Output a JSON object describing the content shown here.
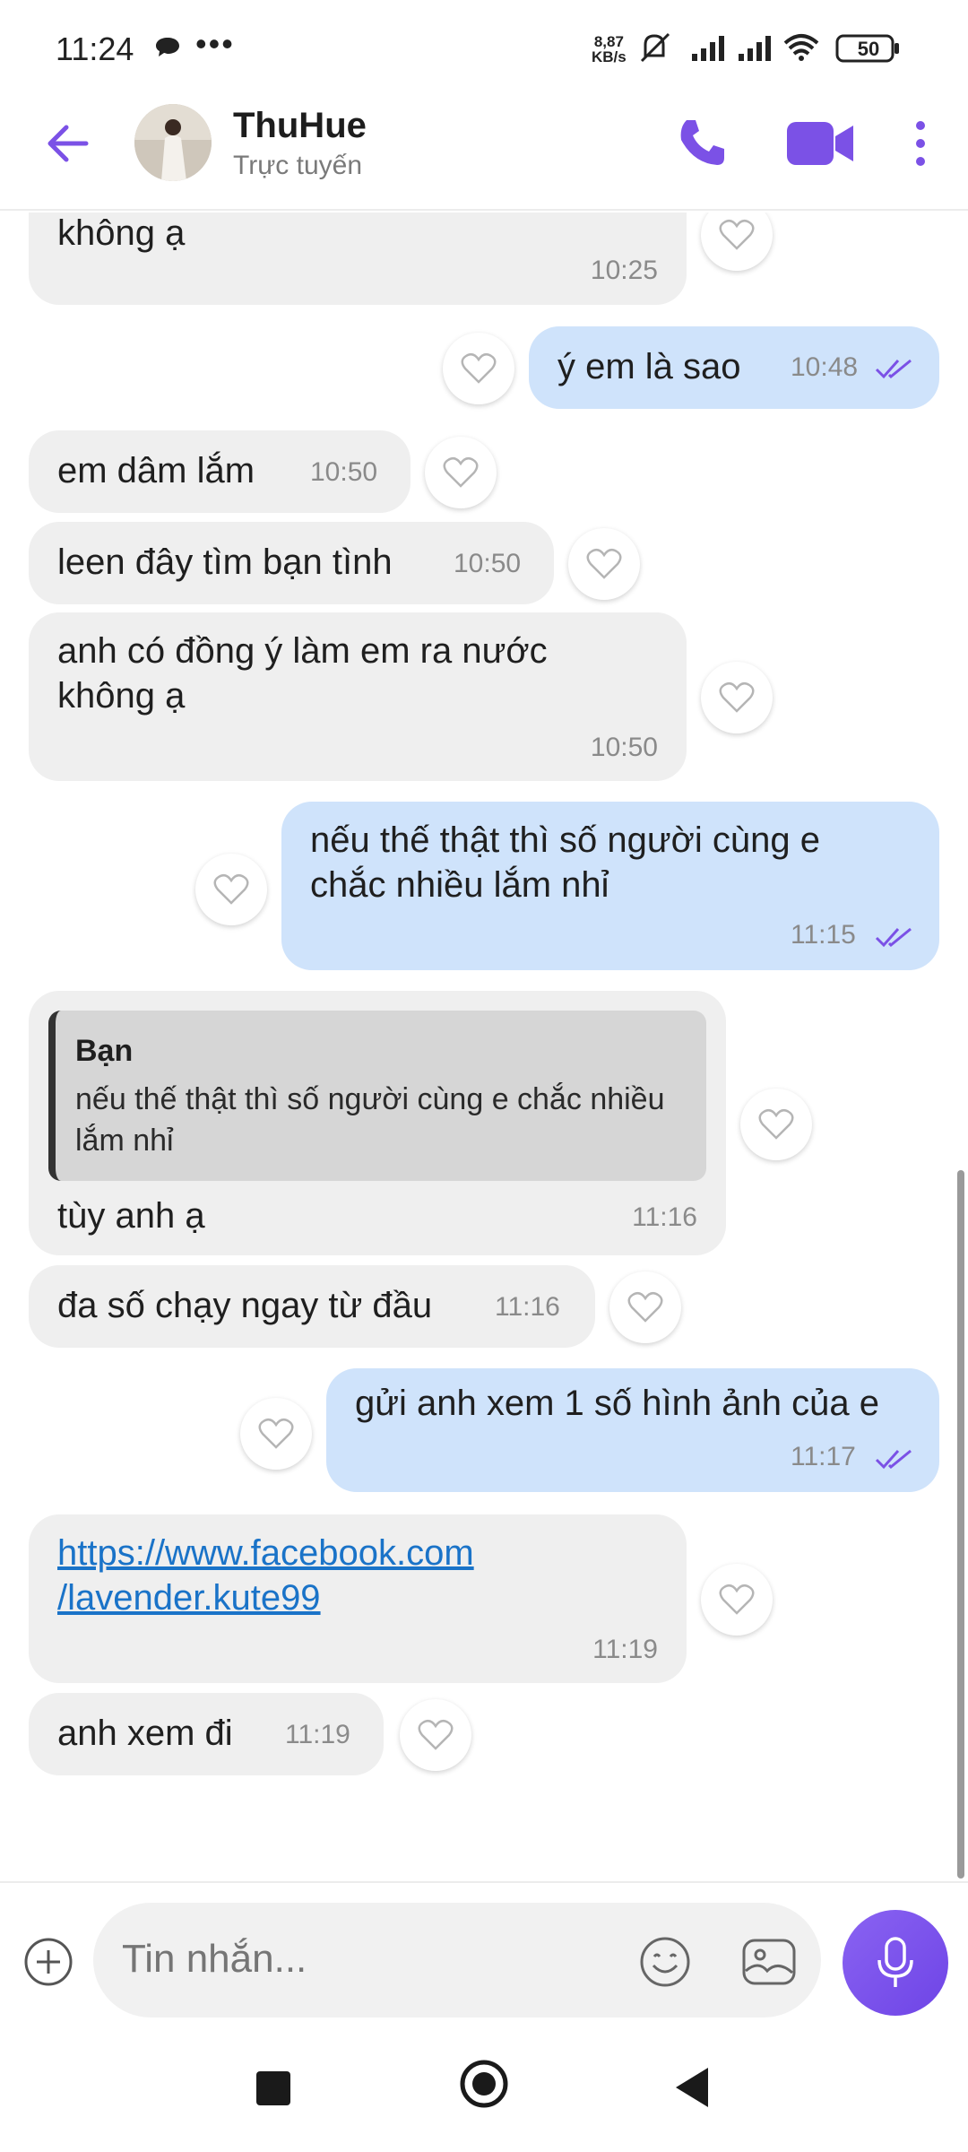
{
  "status_bar": {
    "time": "11:24",
    "dots": "•••",
    "speed_value": "8,87",
    "speed_unit": "KB/s",
    "battery": "50",
    "icons": [
      "chat-bubble-icon",
      "mute-icon",
      "signal-icon",
      "signal-icon",
      "wifi-icon",
      "battery-icon"
    ]
  },
  "header": {
    "contact_name": "ThuHue",
    "status": "Trực tuyến",
    "accent_color": "#7b51e6"
  },
  "messages": [
    {
      "dir": "in",
      "text": "không ạ",
      "time": "10:25"
    },
    {
      "dir": "out",
      "text": "ý em là sao",
      "time": "10:48",
      "read": true
    },
    {
      "dir": "in",
      "text": "em dâm lắm",
      "time": "10:50"
    },
    {
      "dir": "in",
      "text": "leen đây tìm bạn tình",
      "time": "10:50"
    },
    {
      "dir": "in",
      "text": "anh có đồng ý  làm em ra nước\nkhông ạ",
      "time": "10:50"
    },
    {
      "dir": "out",
      "text": "nếu thế thật thì số người cùng e\nchắc nhiều lắm nhỉ",
      "time": "11:15",
      "read": true
    },
    {
      "dir": "in",
      "text": "tùy anh ạ",
      "time": "11:16",
      "quote": {
        "author": "Bạn",
        "text": "nếu thế thật thì số người cùng e chắc nhiều lắm nhỉ"
      }
    },
    {
      "dir": "in",
      "text": "đa số chạy ngay từ đầu",
      "time": "11:16"
    },
    {
      "dir": "out",
      "text": "gửi anh xem 1 số hình ảnh của e",
      "time": "11:17",
      "read": true
    },
    {
      "dir": "in",
      "text": "https://www.facebook.com\n/lavender.kute99",
      "time": "11:19",
      "is_link": true
    },
    {
      "dir": "in",
      "text": "anh xem đi",
      "time": "11:19"
    }
  ],
  "composer": {
    "placeholder": "Tin nhắn..."
  },
  "colors": {
    "incoming_bubble": "#efefef",
    "outgoing_bubble": "#cfe3fb",
    "link": "#1a73c8"
  }
}
